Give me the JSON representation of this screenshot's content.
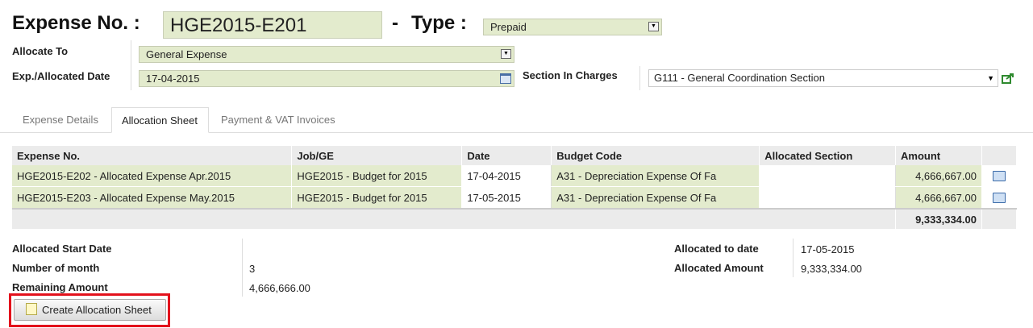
{
  "header": {
    "expense_label": "Expense No. :",
    "expense_value": "HGE2015-E201",
    "dash": "-",
    "type_label": "Type :",
    "type_value": "Prepaid"
  },
  "form": {
    "allocate_to_label": "Allocate To",
    "allocate_to_value": "General Expense",
    "date_label": "Exp./Allocated Date",
    "date_value": "17-04-2015",
    "section_label": "Section In Charges",
    "section_value": "G111 - General Coordination Section"
  },
  "tabs": [
    {
      "label": "Expense Details"
    },
    {
      "label": "Allocation Sheet"
    },
    {
      "label": "Payment & VAT Invoices"
    }
  ],
  "table": {
    "columns": [
      "Expense No.",
      "Job/GE",
      "Date",
      "Budget Code",
      "Allocated Section",
      "Amount"
    ],
    "rows": [
      {
        "expense_no": "HGE2015-E202 - Allocated Expense Apr.2015",
        "job": "HGE2015 - Budget for 2015",
        "date": "17-04-2015",
        "budget_code": "A31 - Depreciation Expense Of Fa",
        "section": "",
        "amount": "4,666,667.00"
      },
      {
        "expense_no": "HGE2015-E203 - Allocated Expense May.2015",
        "job": "HGE2015 - Budget for 2015",
        "date": "17-05-2015",
        "budget_code": "A31 - Depreciation Expense Of Fa",
        "section": "",
        "amount": "4,666,667.00"
      }
    ],
    "total": "9,333,334.00"
  },
  "summary": {
    "start_date_label": "Allocated Start Date",
    "start_date_value": "",
    "months_label": "Number of month",
    "months_value": "3",
    "remaining_label": "Remaining Amount",
    "remaining_value": "4,666,666.00",
    "to_date_label": "Allocated to date",
    "to_date_value": "17-05-2015",
    "amount_label": "Allocated Amount",
    "amount_value": "9,333,334.00"
  },
  "actions": {
    "create_label": "Create Allocation Sheet"
  },
  "colors": {
    "field_bg": "#e3ebcd",
    "highlight": "#e3121c"
  },
  "icons": [
    "dropdown-arrow-icon",
    "calendar-icon",
    "export-icon",
    "document-icon",
    "note-icon"
  ]
}
